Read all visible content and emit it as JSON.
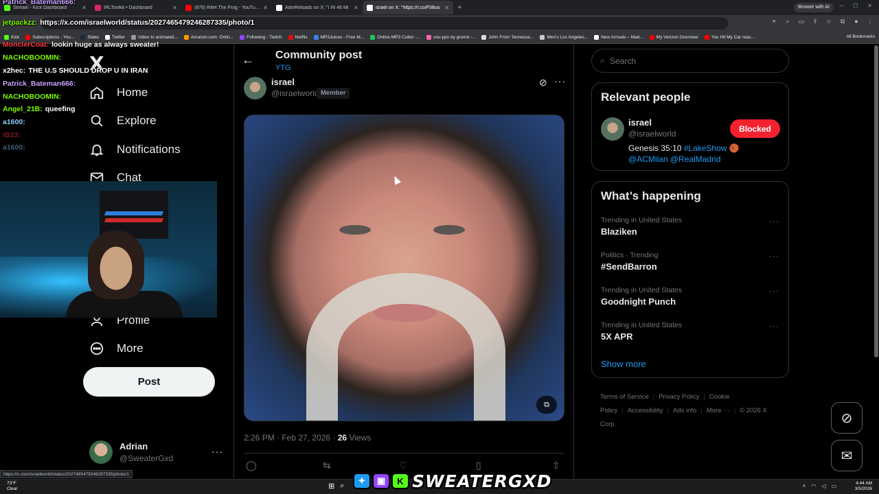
{
  "browser": {
    "tabs": [
      {
        "label": "Stream - Kick Dashboard",
        "color": "#53fc18",
        "active": false
      },
      {
        "label": "IRLToolkit • Dashboard",
        "color": "#e0245e",
        "active": false
      },
      {
        "label": "(876) Rifet The Frog - YouTube",
        "color": "#ff0000",
        "active": false
      },
      {
        "label": "AdinReloads on X: \"I IN 46 Mi",
        "color": "#ffffff",
        "active": false
      },
      {
        "label": "israel on X: \"https://t.co/F58uo",
        "color": "#ffffff",
        "active": true
      }
    ],
    "new_tab_glyph": "+",
    "browse_ai": "Browse with AI",
    "bookmarks": [
      {
        "label": "Kick",
        "color": "#53fc18"
      },
      {
        "label": "Subscriptions - You...",
        "color": "#ff0000"
      },
      {
        "label": "Stake",
        "color": "#1a2c38"
      },
      {
        "label": "Twitter",
        "color": "#ffffff"
      },
      {
        "label": "Video to animated...",
        "color": "#999999"
      },
      {
        "label": "Amazon.com: Onlin...",
        "color": "#ff9900"
      },
      {
        "label": "Following - Twitch",
        "color": "#9146ff"
      },
      {
        "label": "Netflix",
        "color": "#e50914"
      },
      {
        "label": "MP3Juices - Free M...",
        "color": "#3b82f6"
      },
      {
        "label": "Online MP3 Cutter -...",
        "color": "#22c55e"
      },
      {
        "label": "osu-pps by grumd -...",
        "color": "#ff66aa"
      },
      {
        "label": "John From Tennesse...",
        "color": "#dddddd"
      },
      {
        "label": "Men's Los Angeles...",
        "color": "#cccccc"
      },
      {
        "label": "New Arrivals – Mad...",
        "color": "#ffffff"
      },
      {
        "label": "My Verizon Overview",
        "color": "#ee0000"
      },
      {
        "label": "You Hit My Car reac...",
        "color": "#ff0000"
      }
    ],
    "all_bookmarks": "All Bookmarks",
    "status_url": "https://x.com/israelworld/status/2027465479246287335/photo/1"
  },
  "chat": [
    {
      "user": "Patrick_Bateman666:",
      "msg": "",
      "color": "#c8a2ff",
      "faded": false
    },
    {
      "user": "jetpackzz:",
      "msg": "https://x.com/israelworld/status/2027465479246287335/photo/1",
      "color": "#7cfc00",
      "faded": false
    },
    {
      "user": "MonclerCoat:",
      "msg": "lookin huge as always sweater!",
      "color": "#ff3b3b",
      "faded": false
    },
    {
      "user": "NACHOBOOMIN:",
      "msg": "",
      "color": "#7cfc00",
      "faded": false
    },
    {
      "user": "x2hec:",
      "msg": "THE U.S SHOULD DROP U IN IRAN",
      "color": "#ffffff",
      "faded": false
    },
    {
      "user": "Patrick_Bateman666:",
      "msg": "",
      "color": "#c8a2ff",
      "faded": false
    },
    {
      "user": "NACHOBOOMIN:",
      "msg": "",
      "color": "#7cfc00",
      "faded": false
    },
    {
      "user": "Angel_21B:",
      "msg": "queefing",
      "color": "#7cfc00",
      "faded": false
    },
    {
      "user": "a1600:",
      "msg": "",
      "color": "#87cefa",
      "faded": false
    },
    {
      "user": "IB23:",
      "msg": "",
      "color": "#ff3b3b",
      "faded": true
    },
    {
      "user": "a1600:",
      "msg": "",
      "color": "#87cefa",
      "faded": true
    }
  ],
  "nav": {
    "logo": "X",
    "items": [
      {
        "label": "Home",
        "icon": "home-icon"
      },
      {
        "label": "Explore",
        "icon": "search-icon"
      },
      {
        "label": "Notifications",
        "icon": "bell-icon"
      },
      {
        "label": "Chat",
        "icon": "mail-icon"
      },
      {
        "label": "Profile",
        "icon": "person-icon"
      },
      {
        "label": "More",
        "icon": "more-circle-icon"
      }
    ],
    "post_label": "Post",
    "account": {
      "name": "Adrian",
      "handle": "@SweaterGxd"
    }
  },
  "header": {
    "title": "Community post",
    "subtitle": "YTG"
  },
  "post": {
    "author": "israel",
    "handle": "@israelworld",
    "badge": "Member",
    "time": "2:26 PM · Feb 27, 2026 · ",
    "views_count": "26",
    "views_label": " Views"
  },
  "search": {
    "placeholder": "Search"
  },
  "relevant": {
    "title": "Relevant people",
    "name": "israel",
    "handle": "@israelworld",
    "button": "Blocked",
    "bio_text": "Genesis 35:10 ",
    "bio_link1": "#LakeShow",
    "bio_emoji": " 🏀",
    "bio_link2": "@ACMilan @RealMadrid"
  },
  "happening": {
    "title": "What’s happening",
    "trends": [
      {
        "context": "Trending in United States",
        "name": "Blaziken"
      },
      {
        "context": "Politics · Trending",
        "name": "#SendBarron"
      },
      {
        "context": "Trending in United States",
        "name": "Goodnight Punch"
      },
      {
        "context": "Trending in United States",
        "name": "5X APR"
      }
    ],
    "show_more": "Show more"
  },
  "footer": {
    "links": [
      "Terms of Service",
      "Privacy Policy",
      "Cookie Policy",
      "Accessibility",
      "Ads info",
      "More ···",
      "© 2026 X Corp."
    ]
  },
  "taskbar": {
    "temp": "73°F",
    "weather": "Clear",
    "time": "4:44 AM",
    "date": "3/5/2026"
  },
  "streamer": {
    "name": "SWEATERGXD"
  }
}
